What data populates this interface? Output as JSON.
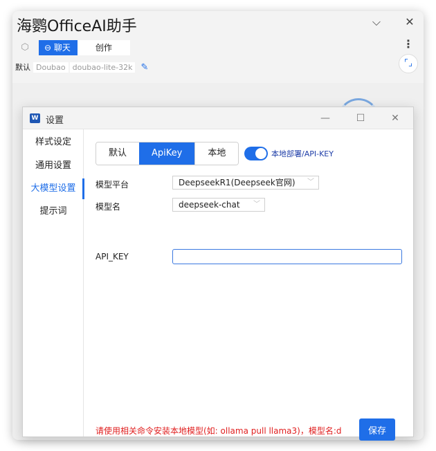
{
  "app": {
    "title": "海鹦OfficeAI助手",
    "tabs": [
      {
        "label": "⊖ 聊天",
        "active": true
      },
      {
        "label": "创作",
        "active": false
      }
    ],
    "model_bar": {
      "default_label": "默认",
      "provider": "Doubao",
      "model": "doubao-lite-32k"
    },
    "icons": {
      "collapse": "chevron-down-icon",
      "close": "close-icon",
      "menu": "more-vertical-icon",
      "scan": "scan-icon",
      "cube": "cube-icon",
      "edit": "pencil-icon"
    }
  },
  "dialog": {
    "title": "设置",
    "app_badge": "W",
    "sidebar": [
      {
        "label": "样式设定",
        "active": false
      },
      {
        "label": "通用设置",
        "active": false
      },
      {
        "label": "大模型设置",
        "active": true
      },
      {
        "label": "提示词",
        "active": false
      }
    ],
    "mode_tabs": [
      {
        "label": "默认",
        "active": false
      },
      {
        "label": "ApiKey",
        "active": true
      },
      {
        "label": "本地",
        "active": false
      }
    ],
    "toggle": {
      "on": true,
      "label": "本地部署/API-KEY"
    },
    "fields": {
      "platform_label": "模型平台",
      "platform_value": "DeepseekR1(Deepseek官网)",
      "model_label": "模型名",
      "model_value": "deepseek-chat",
      "apikey_label": "API_KEY",
      "apikey_value": ""
    },
    "hint": "请使用相关命令安装本地模型(如: ollama pull llama3)，模型名:d",
    "save_label": "保存"
  },
  "colors": {
    "accent": "#1f6ee8",
    "warning": "#e02020"
  }
}
